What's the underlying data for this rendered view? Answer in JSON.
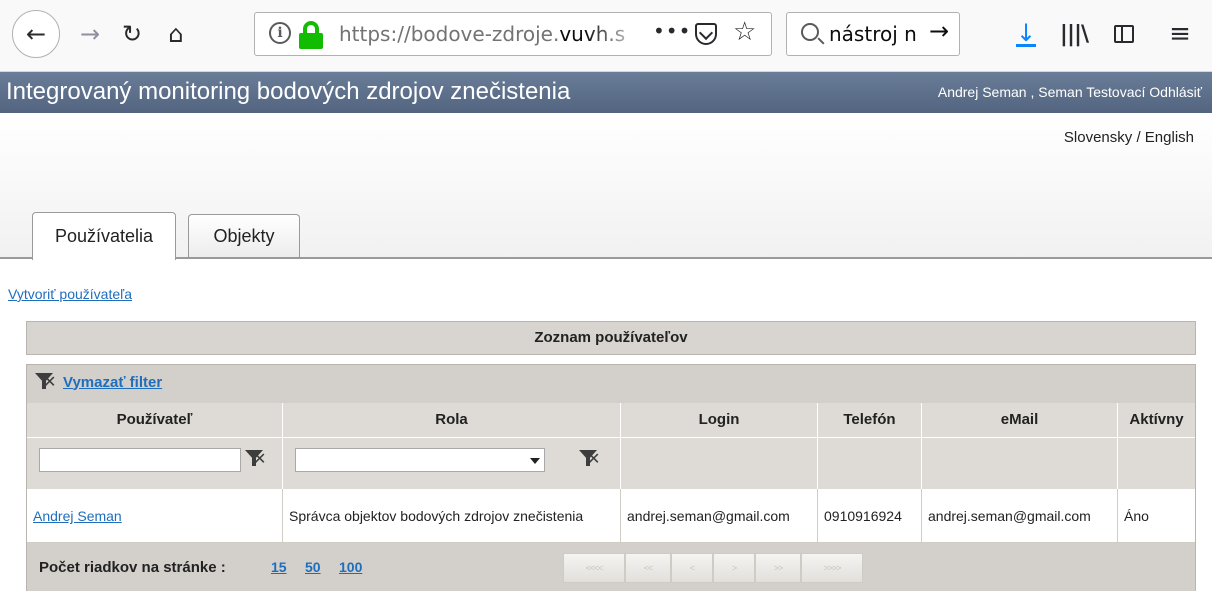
{
  "browser": {
    "url_prefix": "https://bodove-zdroje.",
    "url_domain": "vuvh.s",
    "more_glyph": "•••",
    "search_text": "nástroj n",
    "icons": [
      "back-icon",
      "forward-icon",
      "reload-icon",
      "home-icon",
      "info-icon",
      "lock-icon",
      "more-icon",
      "pocket-icon",
      "star-icon",
      "search-icon",
      "download-icon",
      "library-icon",
      "sidebar-icon",
      "menu-icon"
    ]
  },
  "app": {
    "title": "Integrovaný monitoring bodových zdrojov znečistenia",
    "user_info": "Andrej Seman ,  Seman Testovací Odhlásiť"
  },
  "language": {
    "sk": "Slovensky",
    "separator": "/",
    "en": "English"
  },
  "tabs": [
    {
      "label": "Používatelia",
      "active": true
    },
    {
      "label": "Objekty",
      "active": false
    }
  ],
  "actions": {
    "create_user": "Vytvoriť používateľa"
  },
  "grid": {
    "title": "Zoznam používateľov",
    "clear_filter": "Vymazať filter",
    "columns": [
      "Používateľ",
      "Rola",
      "Login",
      "Telefón",
      "eMail",
      "Aktívny"
    ],
    "filters": {
      "user_value": "",
      "role_value": ""
    },
    "rows": [
      {
        "user": "Andrej Seman",
        "role": "Správca objektov bodových zdrojov znečistenia",
        "login": "andrej.seman@gmail.com",
        "phone": "0910916924",
        "email": "andrej.seman@gmail.com",
        "active": "Áno"
      }
    ],
    "pager": {
      "label": "Počet riadkov na stránke :",
      "sizes": [
        "15",
        "50",
        "100"
      ],
      "buttons": [
        "<<<<",
        "<<",
        "<",
        ">",
        ">>",
        ">>>>"
      ]
    }
  },
  "colors": {
    "header_bg": "#5d6f8a",
    "link": "#1f6ebd",
    "grid_header_bg": "#dedbd6",
    "ssl_green": "#12bc00",
    "download_blue": "#0a84ff"
  }
}
